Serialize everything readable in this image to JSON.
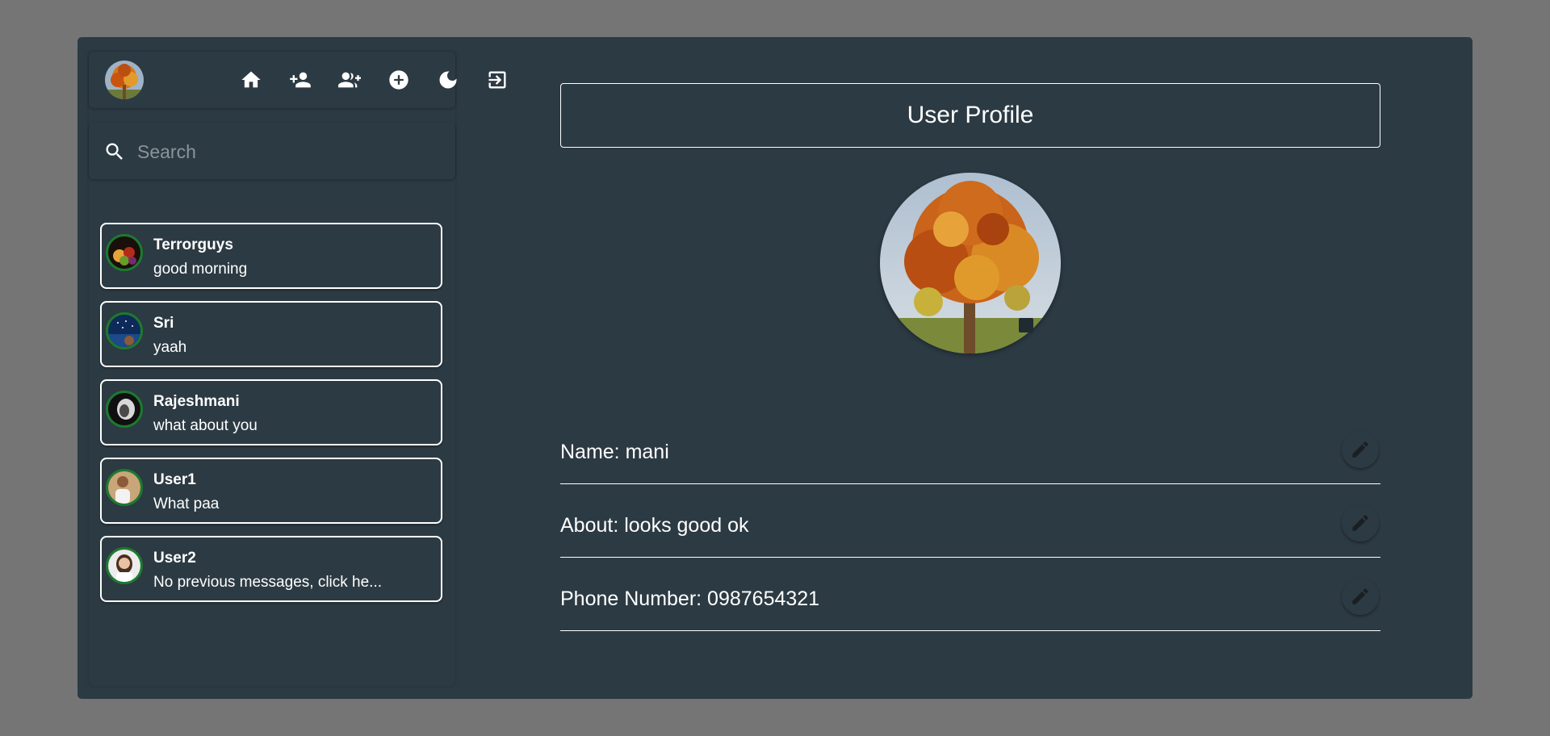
{
  "app": {
    "accent": "#1c7a2e",
    "background": "#2c3a43",
    "page_background": "#757575"
  },
  "sidebar": {
    "nav_icons": [
      "home-icon",
      "person-add-icon",
      "group-add-icon",
      "add-circle-icon",
      "dark-mode-icon",
      "logout-icon"
    ],
    "search": {
      "placeholder": "Search",
      "value": ""
    },
    "chats": [
      {
        "name": "Terrorguys",
        "message": "good morning"
      },
      {
        "name": "Sri",
        "message": "yaah"
      },
      {
        "name": "Rajeshmani",
        "message": "what about you"
      },
      {
        "name": "User1",
        "message": "What paa"
      },
      {
        "name": "User2",
        "message": "No previous messages, click he..."
      }
    ]
  },
  "profile": {
    "title": "User Profile",
    "fields": [
      {
        "label": "Name: mani"
      },
      {
        "label": "About: looks good ok"
      },
      {
        "label": "Phone Number: 0987654321"
      }
    ]
  }
}
